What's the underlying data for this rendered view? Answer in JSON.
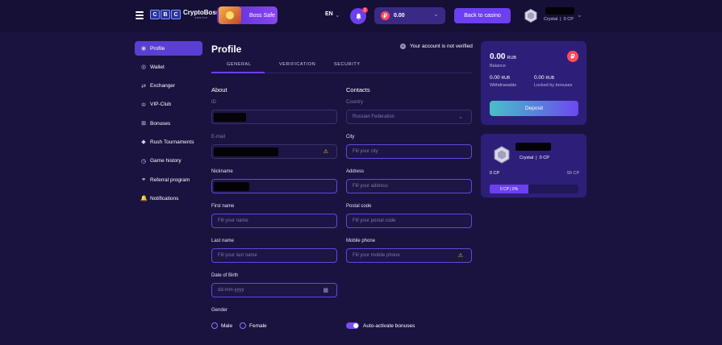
{
  "header": {
    "logo_letters": [
      "C",
      "B",
      "C"
    ],
    "brand": "CryptoBoss",
    "brand_sub": "casino",
    "boss_safe_label": "Boss Safe",
    "language": "EN",
    "notification_count": "1",
    "currency_icon": "₽",
    "balance": "0.00",
    "cashier_label": "Back to casino",
    "user_rank": "Crystal",
    "user_points": "0 CP"
  },
  "sidebar": {
    "items": [
      {
        "label": "Profile",
        "icon": "user-circle-icon",
        "glyph": "◉",
        "active": true
      },
      {
        "label": "Wallet",
        "icon": "wallet-icon",
        "glyph": "◎"
      },
      {
        "label": "Exchanger",
        "icon": "exchange-icon",
        "glyph": "⇄"
      },
      {
        "label": "VIP-Club",
        "icon": "crown-icon",
        "glyph": "♔"
      },
      {
        "label": "Bonuses",
        "icon": "gift-icon",
        "glyph": "⊞"
      },
      {
        "label": "Rush Tournaments",
        "icon": "diamond-icon",
        "glyph": "◆"
      },
      {
        "label": "Game history",
        "icon": "clock-icon",
        "glyph": "◷"
      },
      {
        "label": "Referral program",
        "icon": "referral-icon",
        "glyph": "⚭"
      },
      {
        "label": "Notifications",
        "icon": "bell-icon",
        "glyph": "🔔"
      }
    ]
  },
  "profile": {
    "title": "Profile",
    "verify_note": "Your account is not verified",
    "tabs": [
      "GENERAL",
      "VERIFICATION",
      "SECURITY"
    ],
    "about_heading": "About",
    "contacts_heading": "Contacts",
    "labels": {
      "id": "ID",
      "email": "E-mail",
      "nickname": "Nickname",
      "first_name": "First name",
      "last_name": "Last name",
      "dob": "Date of Birth",
      "gender": "Gender",
      "country": "Country",
      "city": "City",
      "address": "Address",
      "postal": "Postal code",
      "phone": "Mobile phone"
    },
    "values": {
      "country": "Russian Federation"
    },
    "placeholders": {
      "first_name": "Fill your name",
      "last_name": "Fill your last name",
      "dob": "dd-mm-yyyy",
      "city": "Fill your city",
      "address": "Fill your address",
      "postal": "Fill your postal code",
      "phone": "Fill your mobile phone"
    },
    "gender_options": [
      "Male",
      "Female"
    ],
    "auto_bonus_label": "Auto-activate bonuses",
    "auto_bonus_on": true
  },
  "balance_card": {
    "amount": "0.00",
    "currency": "RUB",
    "balance_label": "Balance",
    "withdrawable": "0.00",
    "withdrawable_label": "Withdrawable",
    "locked": "0.00",
    "locked_label": "Locked by bonuses",
    "deposit_label": "Deposit",
    "coin_glyph": "₽"
  },
  "vip_card": {
    "rank": "Crystal",
    "points": "0 CP",
    "progress_start": "0 CP",
    "progress_end": "50 CP",
    "progress_text": "0 CP | 0%",
    "progress_percent": 0
  },
  "colors": {
    "background": "#1a1340",
    "accent": "#6c3ff0",
    "card": "#2d1f79",
    "warning": "#f5c542",
    "currency": "#ff4b5c"
  }
}
